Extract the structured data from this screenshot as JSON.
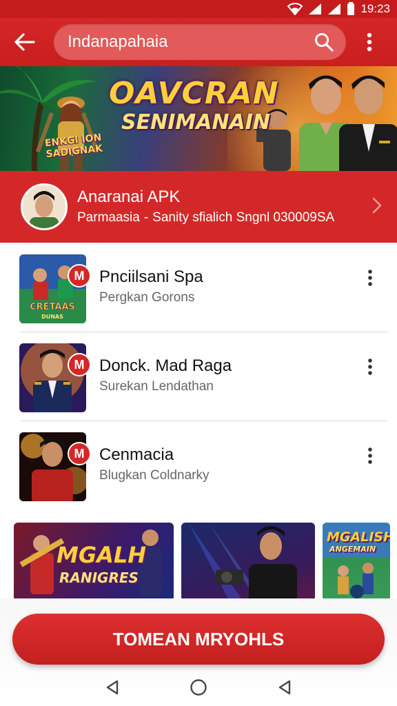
{
  "status_bar": {
    "time": "19:23"
  },
  "app_bar": {
    "search_value": "Indanapahaia"
  },
  "banner": {
    "title": "OAVCRAN",
    "subtitle": "SENIMANAIN",
    "logo_text": "ENKGI ION SADIGNAK"
  },
  "featured": {
    "title": "Anaranai APK",
    "subtitle_left": "Parmaasia",
    "separator": "-",
    "subtitle_right": "Sanity sfialich Sngnl 030009SA"
  },
  "list_items": [
    {
      "title": "Pnciilsani Spa",
      "subtitle": "Pergkan Gorons",
      "thumb_text": "CRETAAS",
      "thumb_subtext": "DUNAS",
      "badge": "M"
    },
    {
      "title": "Donck. Mad Raga",
      "subtitle": "Surekan Lendathan",
      "badge": "M"
    },
    {
      "title": "Cenmacia",
      "subtitle": "Blugkan Coldnarky",
      "badge": "M"
    }
  ],
  "cards": [
    {
      "title": "MGALH",
      "subtitle": "RANIGRES"
    },
    {
      "title": ""
    },
    {
      "title": "MGALISH",
      "subtitle": "ANGEMAIN"
    }
  ],
  "cta": {
    "label": "TOMEAN MRYOHLS"
  },
  "colors": {
    "primary": "#d42828",
    "status_bar": "#c41c1c",
    "search_bg": "#e25a5a"
  }
}
